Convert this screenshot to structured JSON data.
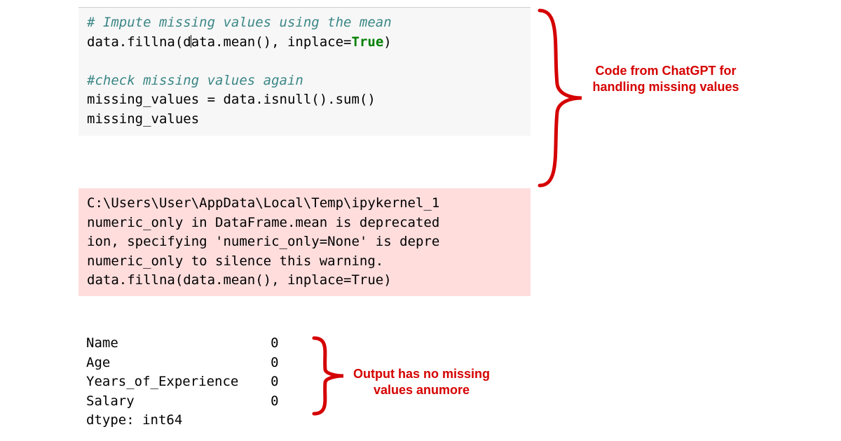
{
  "code": {
    "comment1": "# Impute missing values using the mean",
    "line1_a": "data.fillna(d",
    "line1_b": "ata.mean(), inplace=",
    "line1_kw": "True",
    "line1_c": ")",
    "comment2": "#check missing values again",
    "line2": "missing_values = data.isnull().sum()",
    "line3": "missing_values"
  },
  "warning": {
    "l1": "C:\\Users\\User\\AppData\\Local\\Temp\\ipykernel_1",
    "l2": "numeric_only in DataFrame.mean is deprecated",
    "l3": "ion, specifying 'numeric_only=None' is depre",
    "l4": "numeric_only to silence this warning.",
    "l5": "  data.fillna(data.mean(), inplace=True)"
  },
  "output": {
    "r1_label": "Name",
    "r1_val": "0",
    "r2_label": "Age",
    "r2_val": "0",
    "r3_label": "Years_of_Experience",
    "r3_val": "0",
    "r4_label": "Salary",
    "r4_val": "0",
    "dtype": "dtype: int64"
  },
  "annotations": {
    "a1": "Code from ChatGPT for handling missing values",
    "a2": "Output has no missing values anumore"
  }
}
